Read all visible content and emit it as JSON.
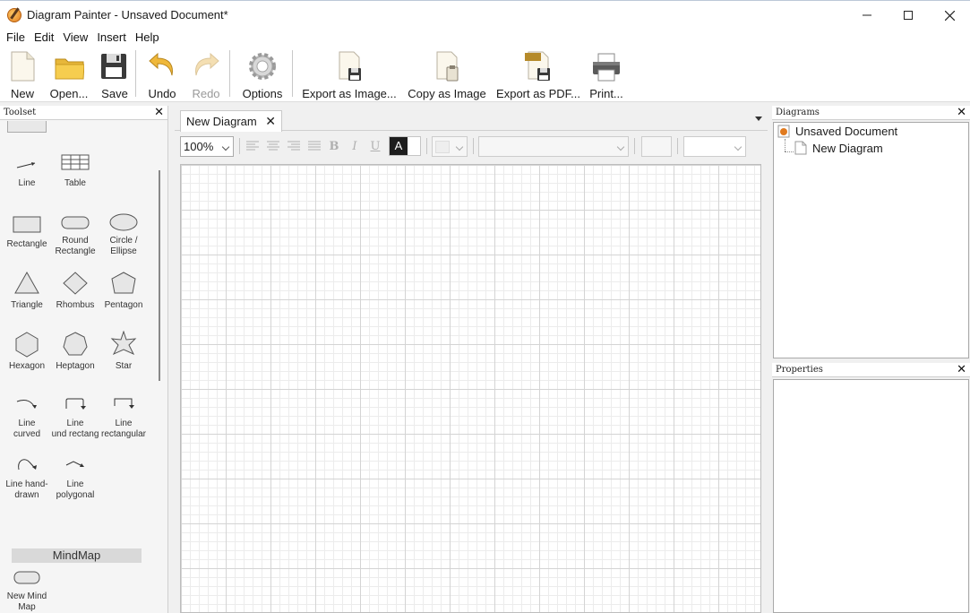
{
  "window": {
    "title": "Diagram Painter - Unsaved Document*",
    "controls": [
      "minimize",
      "maximize",
      "close"
    ]
  },
  "menu": [
    "File",
    "Edit",
    "View",
    "Insert",
    "Help"
  ],
  "toolbar": {
    "new": "New",
    "open": "Open...",
    "save": "Save",
    "undo": "Undo",
    "redo": "Redo",
    "options": "Options",
    "export_image": "Export as Image...",
    "copy_image": "Copy as Image",
    "export_pdf": "Export as PDF...",
    "print": "Print..."
  },
  "toolset": {
    "title": "Toolset",
    "tools": {
      "line": "Line",
      "table": "Table",
      "rectangle": "Rectangle",
      "round_rectangle": [
        "Round",
        "Rectangle"
      ],
      "circle_ellipse": [
        "Circle /",
        "Ellipse"
      ],
      "triangle": "Triangle",
      "rhombus": "Rhombus",
      "pentagon": "Pentagon",
      "hexagon": "Hexagon",
      "heptagon": "Heptagon",
      "star": "Star",
      "line_curved": [
        "Line",
        "curved"
      ],
      "line_round_rectangular": [
        "Line",
        "und rectang"
      ],
      "line_rectangular": [
        "Line",
        "rectangular"
      ],
      "line_hand_drawn": [
        "Line hand-",
        "drawn"
      ],
      "line_polygonal": [
        "Line",
        "polygonal"
      ]
    },
    "mindmap_section": "MindMap",
    "mindmap_tools": {
      "new_mind_map": [
        "New Mind",
        "Map"
      ]
    }
  },
  "editor": {
    "tab_label": "New Diagram",
    "zoom": "100%",
    "text_color_glyph": "A",
    "format_glyphs": {
      "bold": "B",
      "italic": "I",
      "underline": "U"
    }
  },
  "diagrams_panel": {
    "title": "Diagrams",
    "document": "Unsaved Document",
    "diagram": "New Diagram"
  },
  "properties_panel": {
    "title": "Properties"
  }
}
